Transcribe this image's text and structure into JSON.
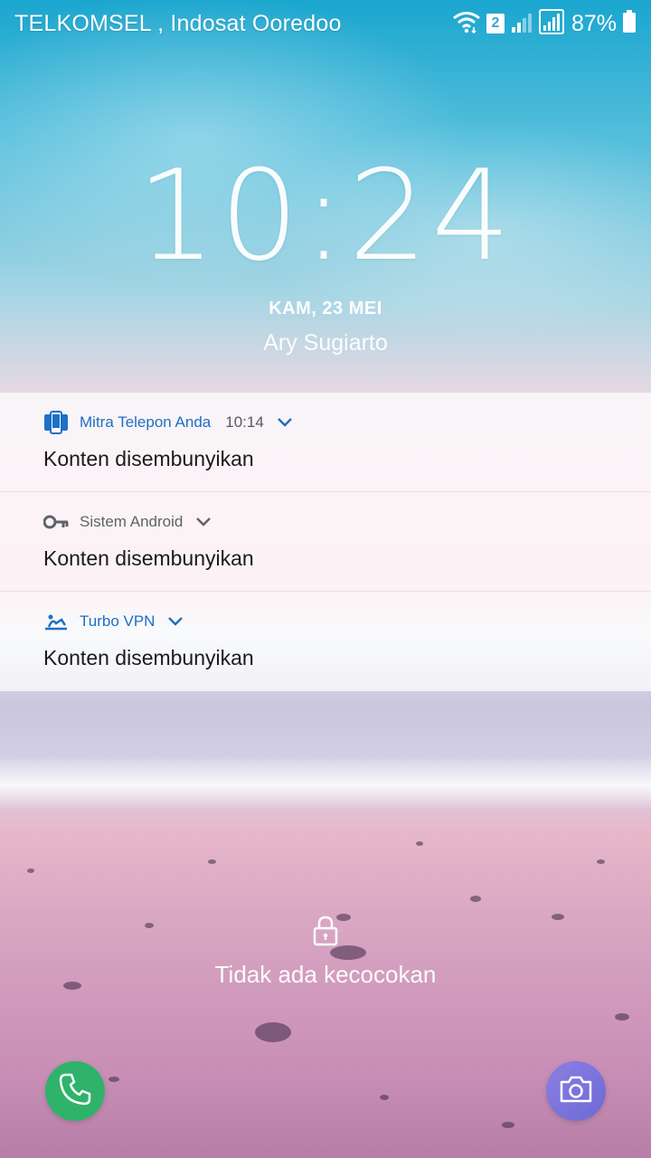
{
  "status_bar": {
    "carrier": "TELKOMSEL , Indosat Ooredoo",
    "sim_badge": "2",
    "battery_percent": "87%"
  },
  "clock": {
    "time": "10:24",
    "date": "KAM, 23 MEI",
    "owner": "Ary Sugiarto"
  },
  "notifications": [
    {
      "app": "Mitra Telepon Anda",
      "time": "10:14",
      "body": "Konten disembunyikan",
      "icon": "phone-app-icon",
      "color": "#1e6fc6"
    },
    {
      "app": "Sistem Android",
      "time": "",
      "body": "Konten disembunyikan",
      "icon": "key-icon",
      "color": "#5f6367"
    },
    {
      "app": "Turbo VPN",
      "time": "",
      "body": "Konten disembunyikan",
      "icon": "turbo-vpn-icon",
      "color": "#1e6fc6"
    }
  ],
  "lock": {
    "hint": "Tidak ada kecocokan"
  },
  "shortcuts": {
    "phone_color": "#2fb36a",
    "camera_color": "#7b73dc"
  }
}
